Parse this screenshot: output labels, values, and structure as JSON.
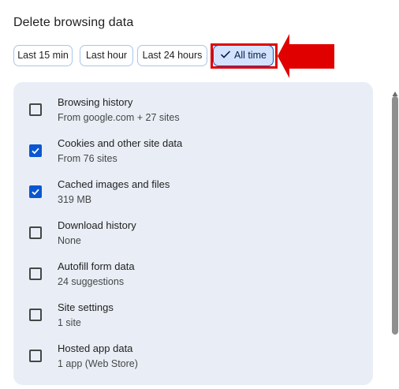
{
  "dialog": {
    "title": "Delete browsing data"
  },
  "time_range": {
    "chips": [
      {
        "label": "Last 15 min",
        "selected": false
      },
      {
        "label": "Last hour",
        "selected": false
      },
      {
        "label": "Last 24 hours",
        "selected": false
      },
      {
        "label": "All time",
        "selected": true
      }
    ]
  },
  "data_types": {
    "items": [
      {
        "label": "Browsing history",
        "sub": "From google.com + 27 sites",
        "checked": false
      },
      {
        "label": "Cookies and other site data",
        "sub": "From 76 sites",
        "checked": true
      },
      {
        "label": "Cached images and files",
        "sub": "319 MB",
        "checked": true
      },
      {
        "label": "Download history",
        "sub": "None",
        "checked": false
      },
      {
        "label": "Autofill form data",
        "sub": "24 suggestions",
        "checked": false
      },
      {
        "label": "Site settings",
        "sub": "1 site",
        "checked": false
      },
      {
        "label": "Hosted app data",
        "sub": "1 app (Web Store)",
        "checked": false
      }
    ]
  },
  "colors": {
    "accent": "#0b57d0",
    "annotation": "#e00000",
    "card_bg": "#e9eef6"
  },
  "icons": {
    "chip_selected": "checkmark-icon",
    "annotation": "red-arrow-icon"
  }
}
